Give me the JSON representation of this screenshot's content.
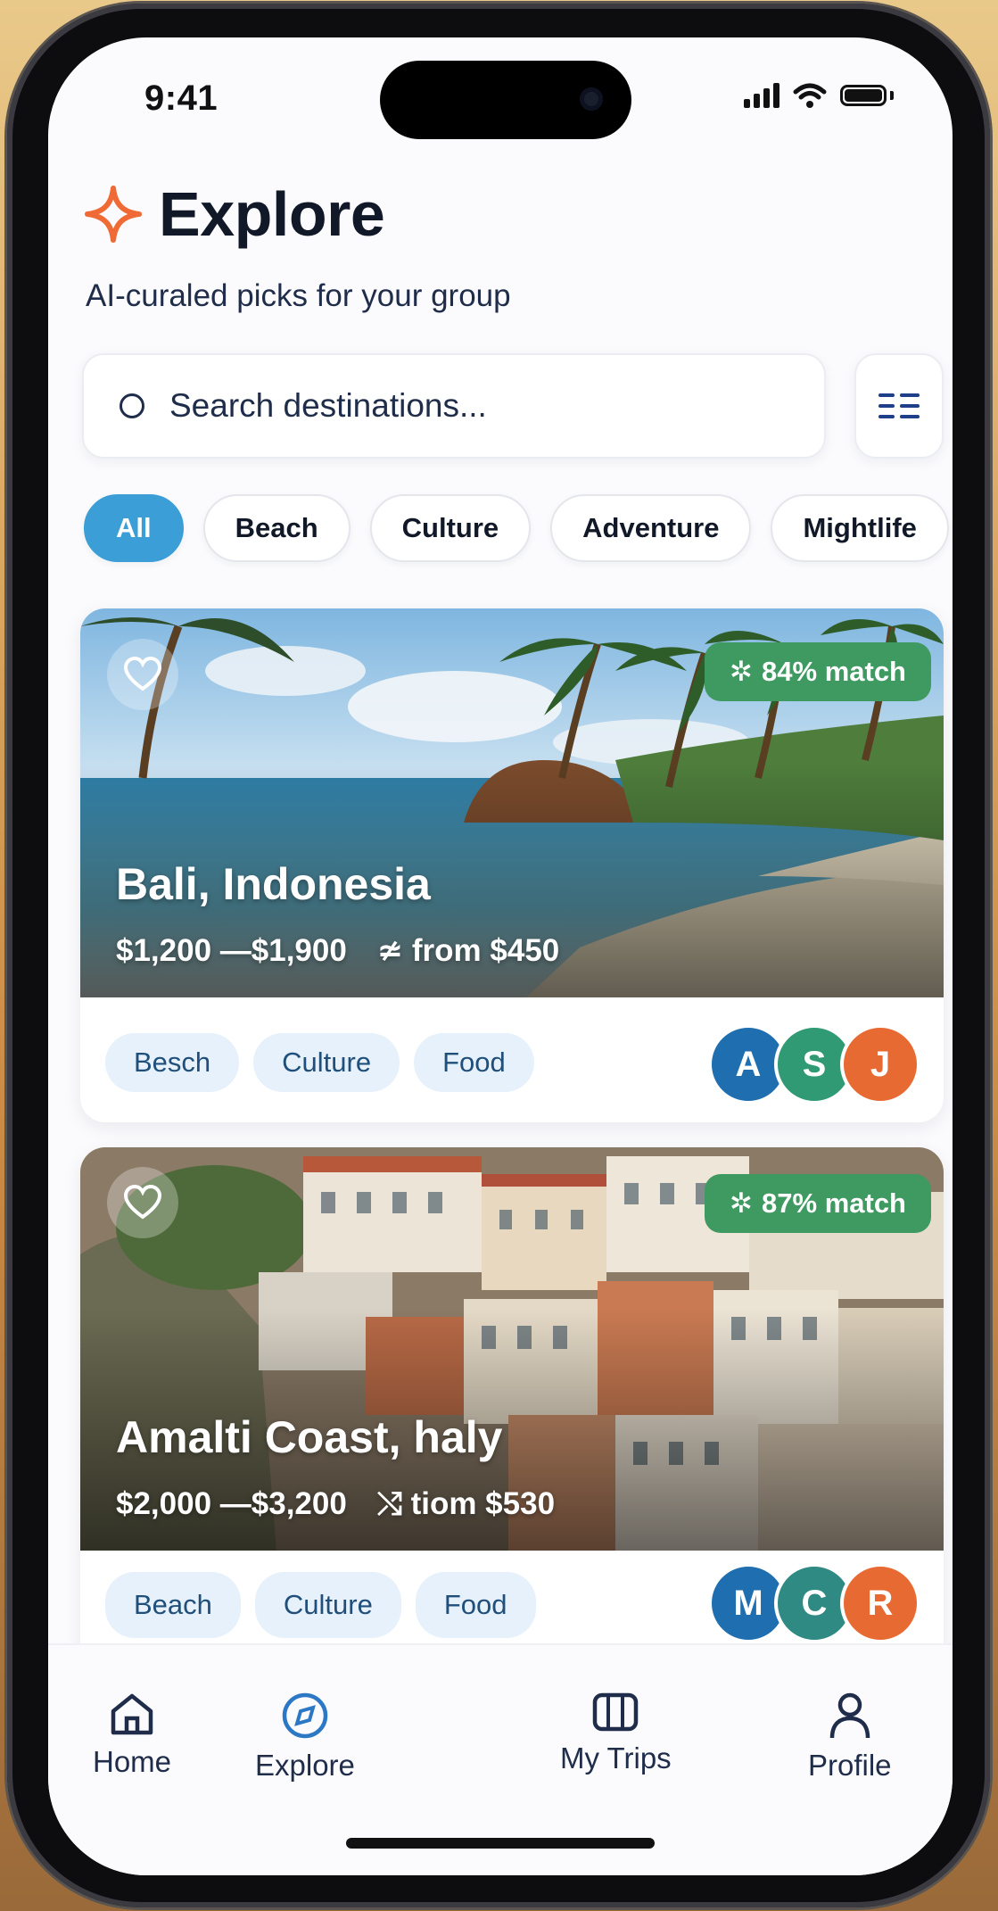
{
  "status_bar": {
    "time": "9:41"
  },
  "header": {
    "title": "Explore",
    "subtitle": "AI-curaled picks for your group"
  },
  "search": {
    "placeholder": "Search destinations..."
  },
  "chips": [
    "All",
    "Beach",
    "Culture",
    "Adventure",
    "Mightlife"
  ],
  "destinations": [
    {
      "name": "Bali, Indonesia",
      "price_range": "$1,200 —$1,900",
      "from": "from $450",
      "from_icon": "≄",
      "match": "84% match",
      "tags": [
        "Besch",
        "Culture",
        "Food"
      ],
      "avatars": [
        {
          "initial": "A",
          "color": "#1f6fb0"
        },
        {
          "initial": "S",
          "color": "#2f9a73"
        },
        {
          "initial": "J",
          "color": "#e86a33"
        }
      ]
    },
    {
      "name": "Amalti Coast, haly",
      "price_range": "$2,000 —$3,200",
      "from": "tiom $530",
      "from_icon": "⤭",
      "match": "87% match",
      "tags": [
        "Beach",
        "Culture",
        "Food"
      ],
      "avatars": [
        {
          "initial": "M",
          "color": "#1f6fb0"
        },
        {
          "initial": "C",
          "color": "#2f8a84"
        },
        {
          "initial": "R",
          "color": "#e86a33"
        }
      ]
    }
  ],
  "tabs": [
    {
      "label": "Home",
      "icon": "home-icon"
    },
    {
      "label": "Explore",
      "icon": "compass-icon",
      "active": true
    },
    {
      "label": "My Trips",
      "icon": "trips-icon"
    },
    {
      "label": "Profile",
      "icon": "person-icon"
    }
  ],
  "colors": {
    "accent": "#3b9ed6",
    "match_badge": "#3f9a61",
    "sparkle": "#f06a35"
  }
}
